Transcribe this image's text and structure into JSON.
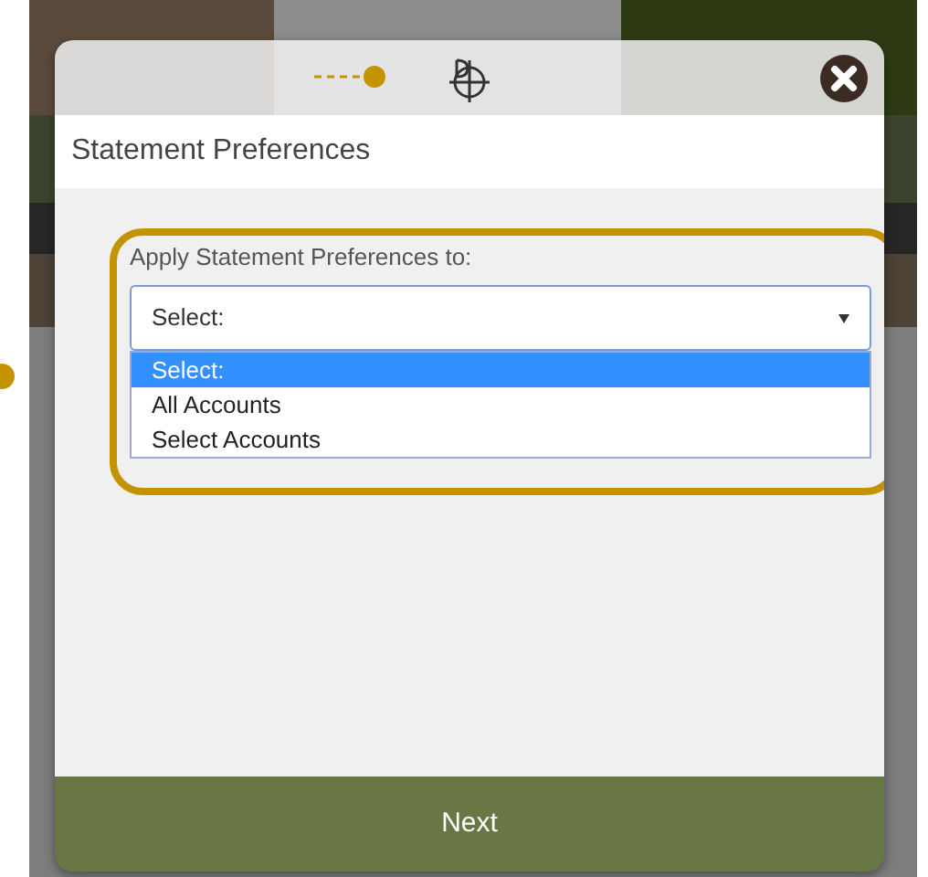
{
  "modal": {
    "title": "Statement Preferences",
    "field_label": "Apply Statement Preferences to:",
    "select": {
      "value": "Select:",
      "options": [
        {
          "label": "Select:",
          "selected": true
        },
        {
          "label": "All Accounts",
          "selected": false
        },
        {
          "label": "Select Accounts",
          "selected": false
        }
      ]
    },
    "next_button": "Next"
  }
}
